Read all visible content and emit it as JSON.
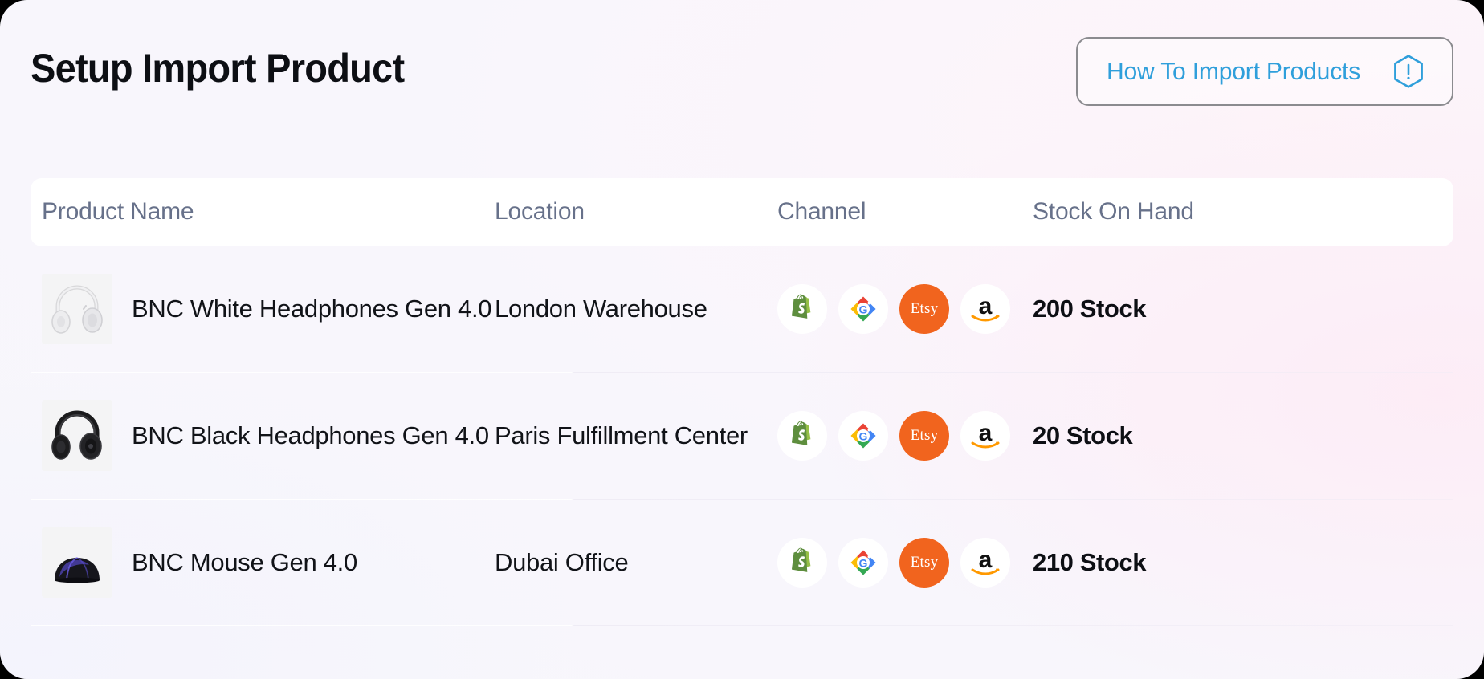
{
  "header": {
    "title": "Setup Import Product",
    "help_button_label": "How To Import Products",
    "help_icon": "hexagon-exclamation-icon",
    "accent_blue": "#2f9fdb",
    "title_color": "#0d0f14"
  },
  "table": {
    "columns": [
      {
        "key": "product",
        "label": "Product Name"
      },
      {
        "key": "location",
        "label": "Location"
      },
      {
        "key": "channel",
        "label": "Channel"
      },
      {
        "key": "stock",
        "label": "Stock On Hand"
      }
    ],
    "header_text_color": "#67718a",
    "rows": [
      {
        "thumbnail": "white-headphones-image",
        "product_name": "BNC White Headphones Gen 4.0",
        "location": "London Warehouse",
        "channels": [
          "shopify-icon",
          "google-shopping-icon",
          "etsy-icon",
          "amazon-icon"
        ],
        "stock": "200 Stock"
      },
      {
        "thumbnail": "black-headphones-image",
        "product_name": "BNC Black Headphones Gen 4.0",
        "location": "Paris Fulfillment Center",
        "channels": [
          "shopify-icon",
          "google-shopping-icon",
          "etsy-icon",
          "amazon-icon"
        ],
        "stock": "20 Stock"
      },
      {
        "thumbnail": "computer-mouse-image",
        "product_name": "BNC Mouse Gen 4.0",
        "location": "Dubai Office",
        "channels": [
          "shopify-icon",
          "google-shopping-icon",
          "etsy-icon",
          "amazon-icon"
        ],
        "stock": "210 Stock"
      }
    ]
  },
  "channel_labels": {
    "etsy_wordmark": "Etsy"
  }
}
